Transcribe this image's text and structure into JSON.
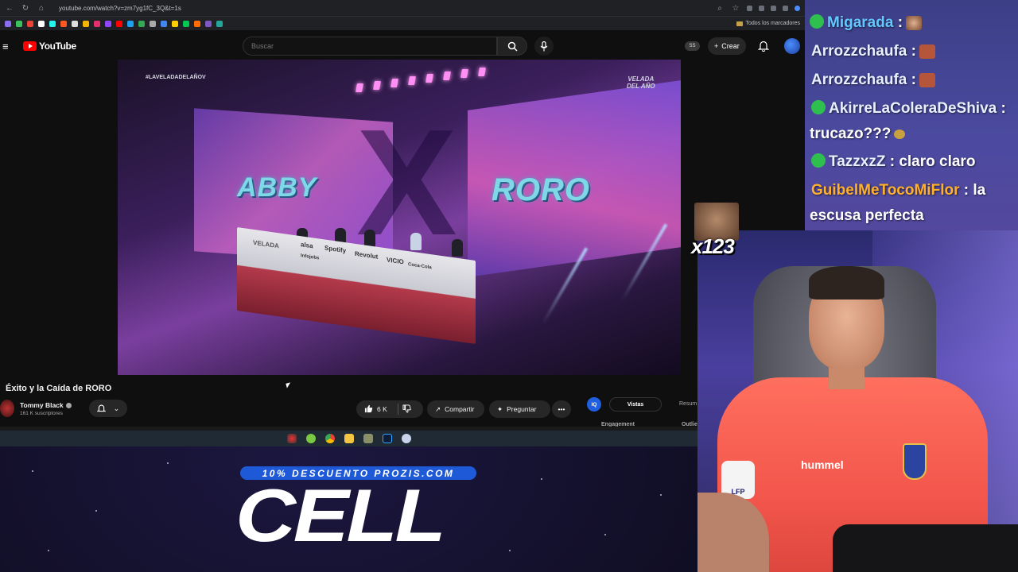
{
  "browser": {
    "url": "youtube.com/watch?v=zm7yg1fC_3Q&t=1s",
    "bookmarks_all": "Todos los marcadores"
  },
  "youtube": {
    "logo_text": "YouTube",
    "search_placeholder": "Buscar",
    "ss_badge": "SS",
    "create_label": "Crear"
  },
  "video": {
    "hashtag": "#LAVELADADELAÑOV",
    "logo_line1": "VELADA",
    "logo_line2": "DEL AÑO",
    "fighter_left": "ABBY",
    "fighter_right": "RORO",
    "desk_brand": "VELADA",
    "sponsors": [
      "alsa",
      "Spotify",
      "Revolut",
      "VICIO",
      "Coca-Cola",
      "Infojobs"
    ],
    "title": "Éxito y la Caída de RORO",
    "channel_name": "Tommy Black",
    "channel_subs": "161 K suscriptores",
    "likes": "6 K",
    "share_label": "Compartir",
    "ask_label": "Preguntar",
    "more_label": "•••",
    "iq_label": "IQ",
    "tab_active": "Vistas",
    "tab_other": "Resum",
    "metric_left": "Engagement",
    "metric_right": "Outlie"
  },
  "chat": {
    "messages": [
      {
        "user": "Migarada",
        "text": ":",
        "badge": true,
        "user_color": "#63c8ff"
      },
      {
        "user": "Arrozzchaufa",
        "text": ":",
        "badge": false,
        "user_color": "#e6f0ff"
      },
      {
        "user": "Arrozzchaufa",
        "text": ":",
        "badge": false,
        "user_color": "#e6f0ff"
      },
      {
        "user": "AkirreLaColeraDeShiva",
        "text": ":",
        "badge": true,
        "user_color": "#e6f0ff"
      },
      {
        "user": "",
        "text": "trucazo???",
        "badge": false,
        "user_color": "#ffffff"
      },
      {
        "user": "TazzxzZ",
        "text": ": claro claro",
        "badge": true,
        "user_color": "#e6f0ff"
      },
      {
        "user": "GuibelMeTocoMiFlor",
        "text": ": la",
        "badge": false,
        "user_color": "#ffb02e"
      },
      {
        "user": "",
        "text": "escusa perfecta",
        "badge": false,
        "user_color": "#ffffff"
      }
    ]
  },
  "overlay": {
    "emote_count": "x123"
  },
  "webcam": {
    "shirt_brand": "hummel",
    "patch_text": "LFP"
  },
  "ad": {
    "promo": "10% DESCUENTO PROZIS.COM",
    "product": "CELL"
  },
  "colors": {
    "youtube_red": "#ff0000",
    "chat_bg": "#4b4aa0",
    "promo_blue": "#1e5ad8",
    "shirt": "#f2554b"
  }
}
